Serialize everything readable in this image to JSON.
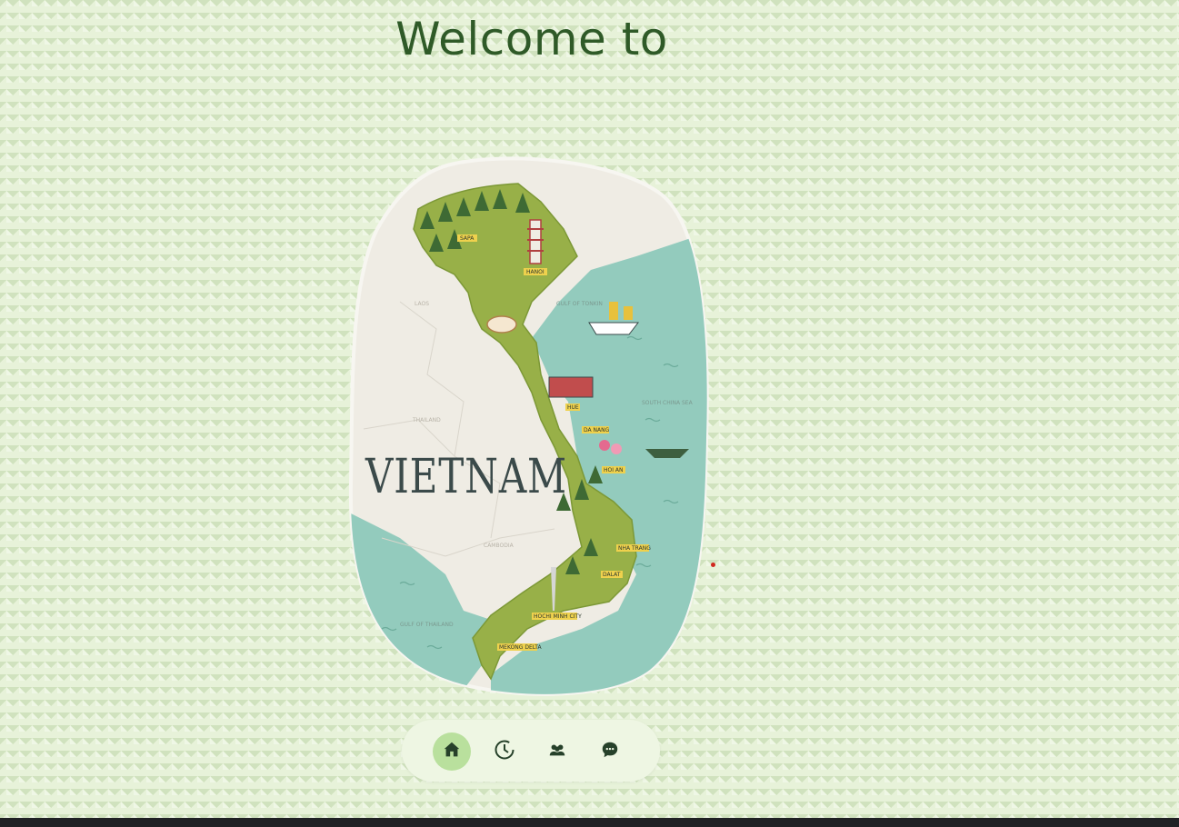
{
  "header": {
    "title": "Welcome to"
  },
  "map": {
    "country": "VIETNAM",
    "labels": {
      "sapa": "SAPA",
      "hanoi": "HANOI",
      "hue": "HUE",
      "danang": "DA NANG",
      "hoian": "HOI AN",
      "nhatrang": "NHA TRANG",
      "dalat": "DALAT",
      "hcmc": "HOCHI MINH CITY",
      "mekong": "MEKONG DELTA",
      "gulf_tonkin": "GULF OF TONKIN",
      "south_china_sea": "SOUTH CHINA SEA",
      "laos": "LAOS",
      "thailand": "THAILAND",
      "cambodia": "CAMBODIA",
      "gulf_thailand": "GULF OF THAILAND"
    },
    "colors": {
      "land": "#98b048",
      "sea": "#93cbbd",
      "paper": "#efece4",
      "outline": "#3b4a4a"
    }
  },
  "nav": {
    "items": [
      {
        "name": "home",
        "icon": "home-icon",
        "active": true
      },
      {
        "name": "history",
        "icon": "clock-icon",
        "active": false
      },
      {
        "name": "community",
        "icon": "people-icon",
        "active": false
      },
      {
        "name": "chat",
        "icon": "chat-bubble-icon",
        "active": false
      }
    ]
  }
}
